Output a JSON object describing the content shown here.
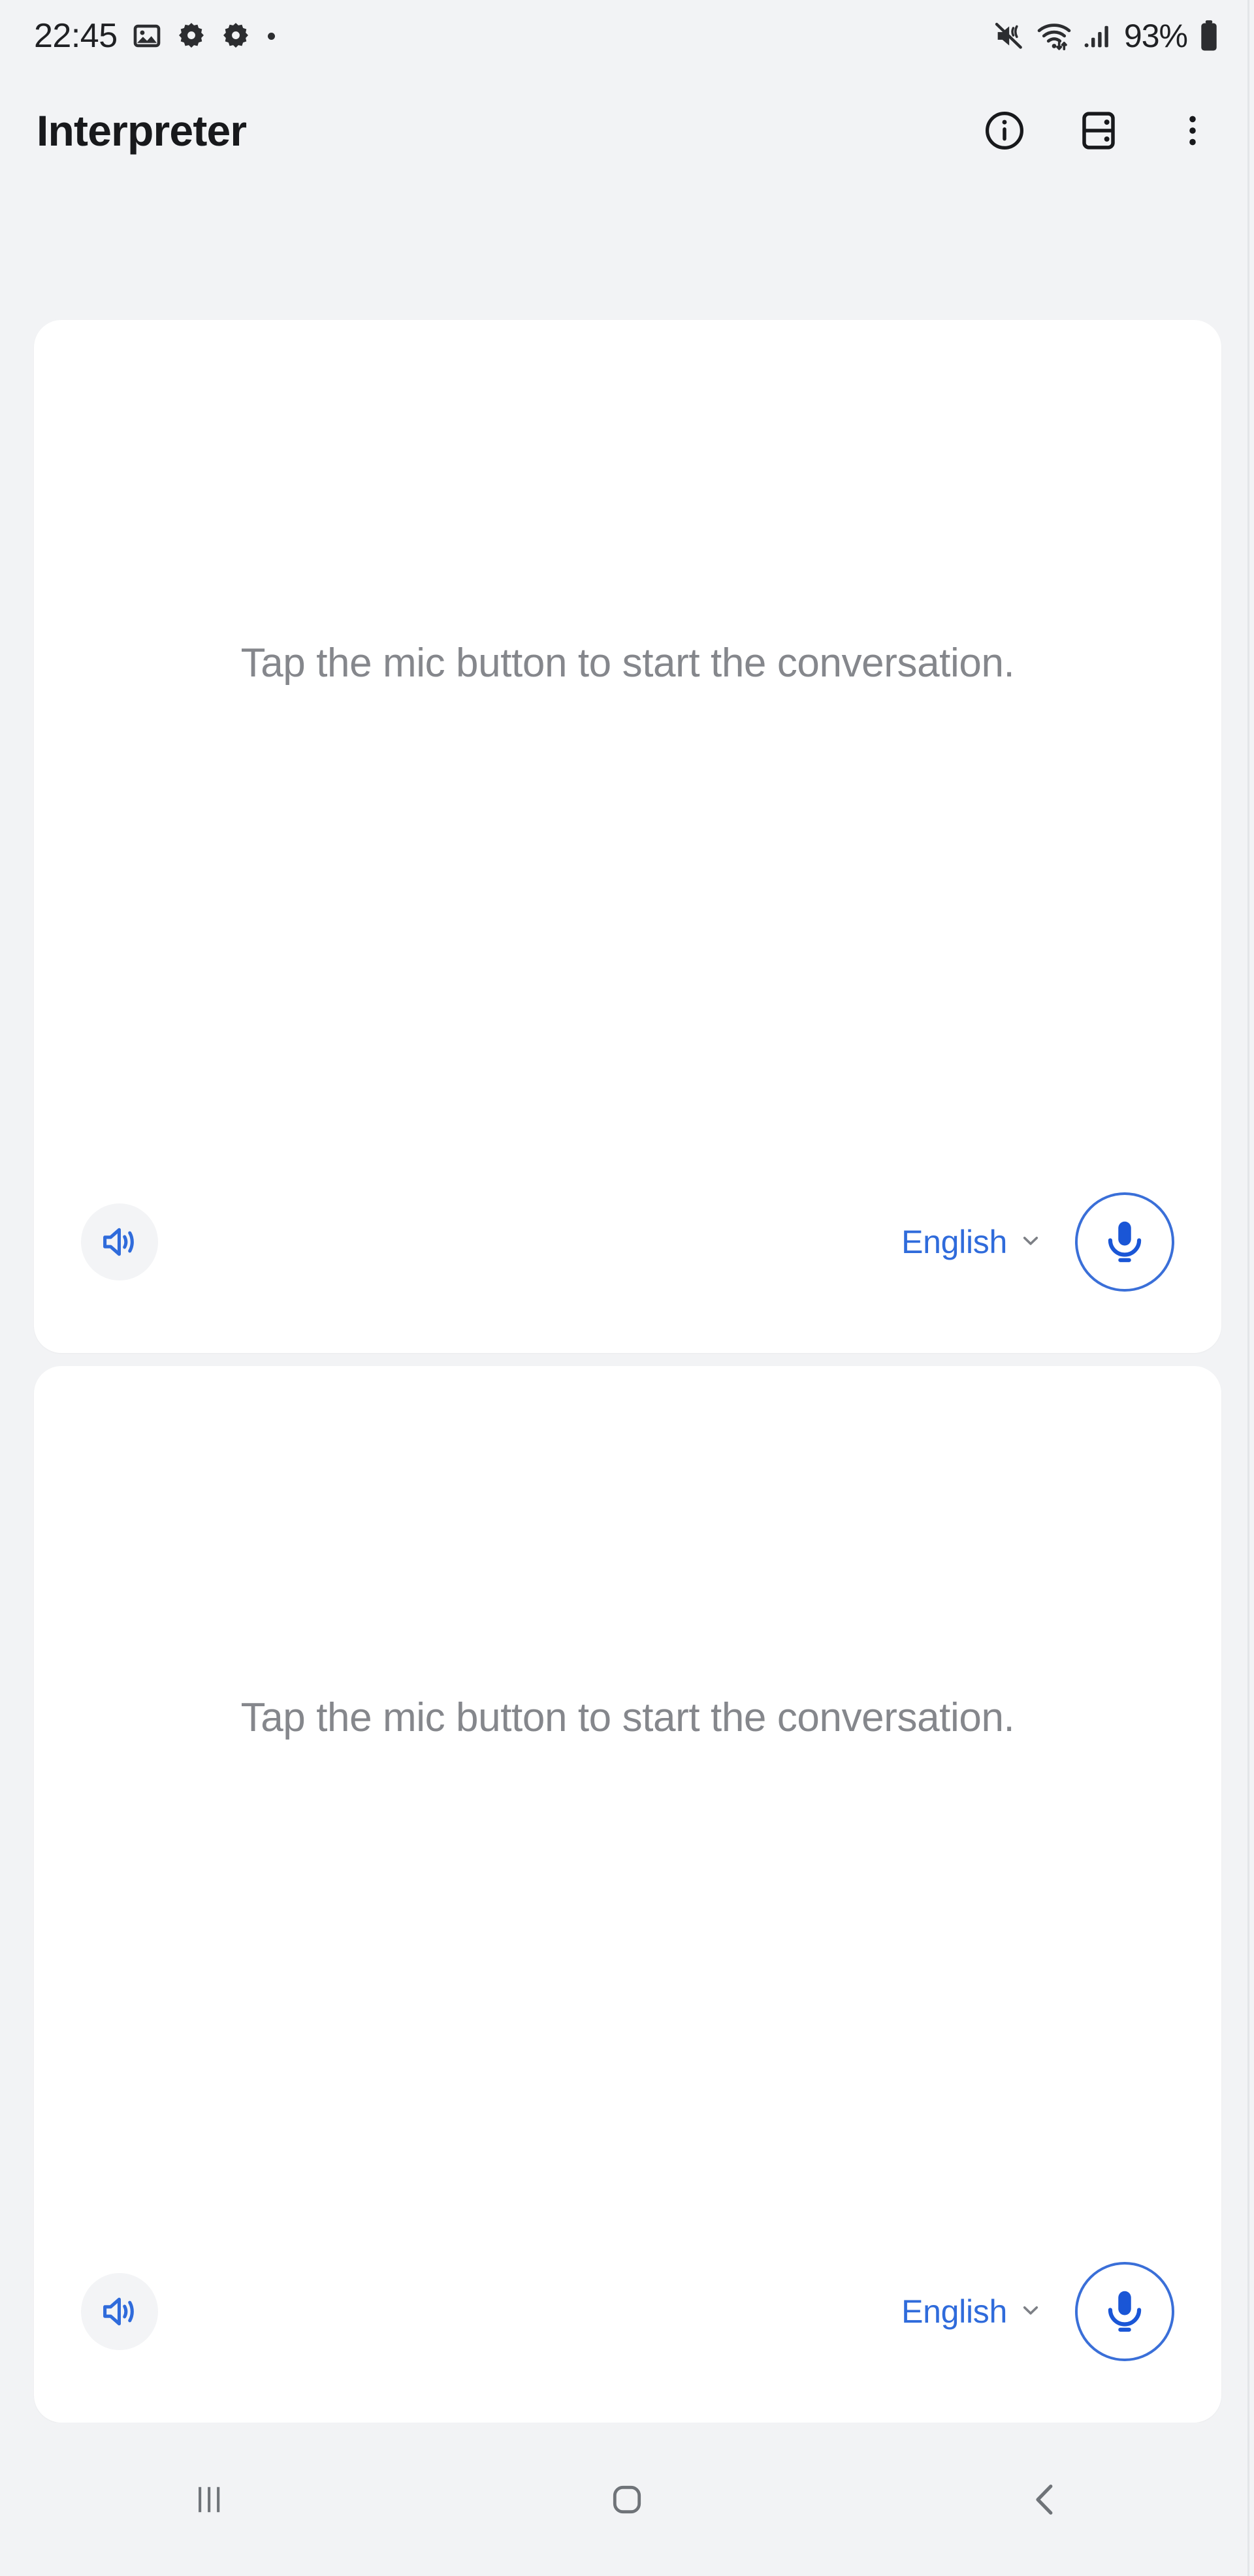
{
  "status_bar": {
    "time": "22:45",
    "battery_percent": "93%",
    "left_icons": [
      "photo-icon",
      "settings-gear-icon",
      "settings-gear-icon",
      "notification-dot-icon"
    ],
    "right_icons": [
      "mute-vibrate-icon",
      "wifi-icon",
      "cellular-signal-icon",
      "battery-icon"
    ]
  },
  "app_bar": {
    "title": "Interpreter",
    "actions": [
      {
        "name": "info-icon",
        "label": "Info"
      },
      {
        "name": "split-view-icon",
        "label": "Split view"
      },
      {
        "name": "overflow-menu-icon",
        "label": "More options"
      }
    ]
  },
  "cards": [
    {
      "placeholder": "Tap the mic button to start the conversation.",
      "speaker_label": "Speaker",
      "language": "English",
      "mic_label": "Microphone"
    },
    {
      "placeholder": "Tap the mic button to start the conversation.",
      "speaker_label": "Speaker",
      "language": "English",
      "mic_label": "Microphone"
    }
  ],
  "nav_bar": {
    "recents_label": "Recents",
    "home_label": "Home",
    "back_label": "Back"
  },
  "colors": {
    "accent_blue": "#2f6bdb",
    "mic_blue": "#1a56d6",
    "background": "#f2f3f5",
    "card": "#ffffff",
    "placeholder_text": "#85878c",
    "title_text": "#18191c"
  }
}
